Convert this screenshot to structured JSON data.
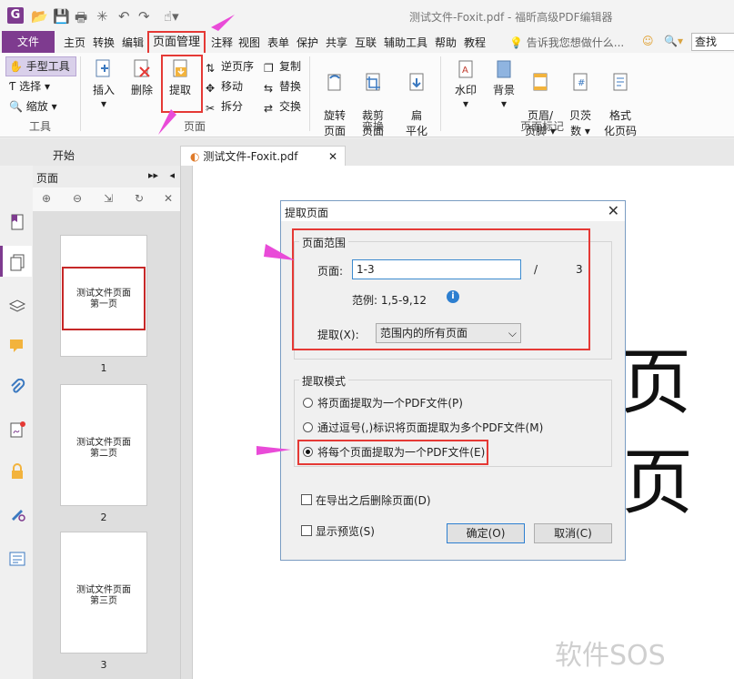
{
  "window": {
    "title": "测试文件-Foxit.pdf - 福昕高级PDF编辑器"
  },
  "menu": {
    "file": "文件",
    "items": [
      "主页",
      "转换",
      "编辑",
      "页面管理",
      "注释",
      "视图",
      "表单",
      "保护",
      "共享",
      "互联",
      "辅助工具",
      "帮助",
      "教程"
    ],
    "tell_me": "告诉我您想做什么...",
    "search_placeholder": "查找"
  },
  "ribbon": {
    "tools": {
      "hand": "手型工具",
      "select": "选择",
      "zoom": "缩放",
      "group": "工具"
    },
    "pages": {
      "insert": "插入",
      "delete": "删除",
      "extract": "提取",
      "reverse": "逆页序",
      "move": "移动",
      "split": "拆分",
      "copy": "复制",
      "replace": "替换",
      "swap": "交换",
      "group": "页面"
    },
    "convert": {
      "rotate": "旋转\n页面",
      "crop": "裁剪\n页面",
      "flatten": "扁\n平化",
      "group": "变换"
    },
    "marks": {
      "watermark": "水印",
      "background": "背景",
      "header_footer": "页眉/\n页脚",
      "bates": "贝茨\n数",
      "format_page_num": "格式\n化页码",
      "group": "页面标记"
    }
  },
  "tabs": {
    "start": "开始",
    "doc": "测试文件-Foxit.pdf"
  },
  "pages_panel": {
    "title": "页面",
    "thumbnails": [
      {
        "text": "测试文件页面\n第一页",
        "num": "1"
      },
      {
        "text": "测试文件页面\n第二页",
        "num": "2"
      },
      {
        "text": "测试文件页面\n第三页",
        "num": "3"
      }
    ]
  },
  "doc_glyphs": [
    "页",
    "页"
  ],
  "dialog": {
    "title": "提取页面",
    "range_legend": "页面范围",
    "pages_label": "页面:",
    "pages_value": "1-3",
    "total_sep": "/",
    "total": "3",
    "example": "范例: 1,5-9,12",
    "extract_label": "提取(X):",
    "extract_option": "范围内的所有页面",
    "mode_legend": "提取模式",
    "mode_options": [
      "将页面提取为一个PDF文件(P)",
      "通过逗号(,)标识将页面提取为多个PDF文件(M)",
      "将每个页面提取为一个PDF文件(E)"
    ],
    "mode_selected": 2,
    "delete_after": "在导出之后删除页面(D)",
    "show_preview": "显示预览(S)",
    "ok": "确定(O)",
    "cancel": "取消(C)"
  },
  "watermark_text": "软件SOS",
  "colors": {
    "accent": "#7e3b8f",
    "highlight": "#e53935",
    "arrow": "#e94bd8"
  }
}
